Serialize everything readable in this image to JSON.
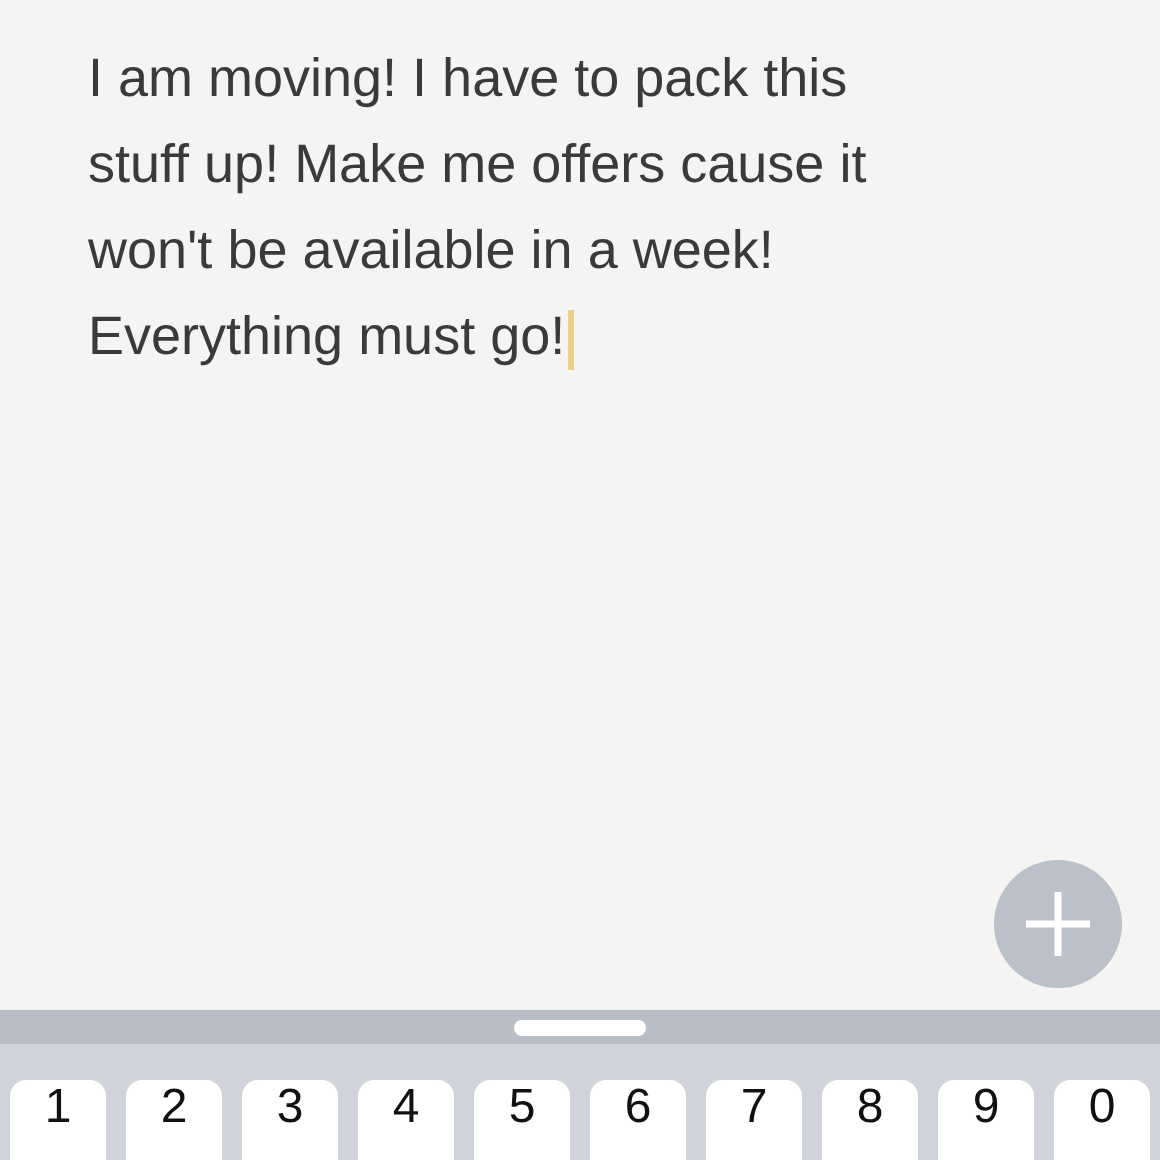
{
  "note": {
    "lines": [
      "I am moving! I have to pack this",
      "stuff up! Make me offers cause it",
      "won't be available in a week!",
      "Everything must go!"
    ]
  },
  "keyboard": {
    "keys": [
      "1",
      "2",
      "3",
      "4",
      "5",
      "6",
      "7",
      "8",
      "9",
      "0"
    ]
  }
}
